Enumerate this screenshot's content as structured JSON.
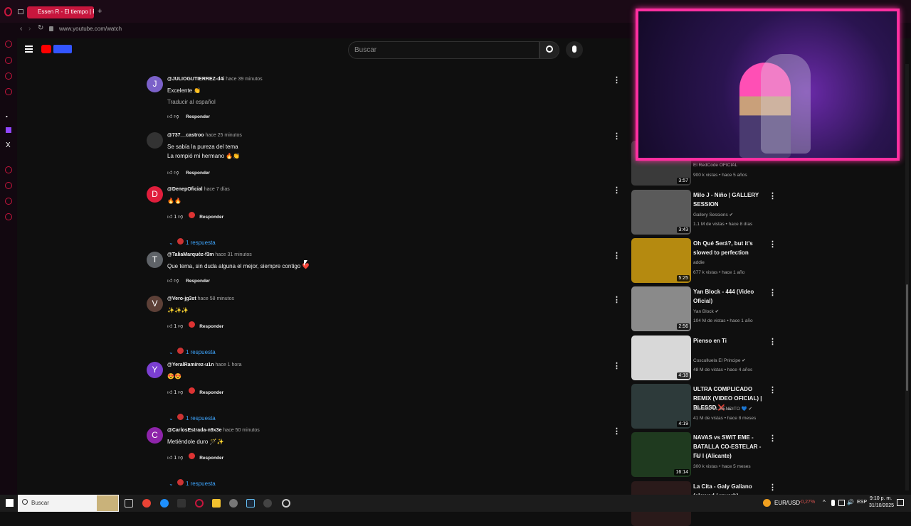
{
  "browser": {
    "tab_title": "Essen R - El tiempo | Prod",
    "url": "www.youtube.com/watch"
  },
  "youtube": {
    "search_placeholder": "Buscar"
  },
  "comments": [
    {
      "initial": "J",
      "color": "#7b61c9",
      "author": "@JULIOGUTIERREZ-d4i",
      "time": "hace 39 minutos",
      "text": "Excelente 👏",
      "translate": "Traducir al español",
      "likes": "",
      "reply": "Responder",
      "replies": ""
    },
    {
      "initial": "",
      "color": "#333333",
      "author": "@737__castroo",
      "time": "hace 25 minutos",
      "text": "Se sabía la pureza del tema",
      "text2": "La rompió mi hermano 🔥👏",
      "likes": "",
      "reply": "Responder",
      "replies": ""
    },
    {
      "initial": "D",
      "color": "#e01e3c",
      "author": "@DenepOficial",
      "time": "hace 7 días",
      "text": "🔥🔥",
      "likes": "1",
      "reply": "Responder",
      "replies": "1 respuesta"
    },
    {
      "initial": "T",
      "color": "#5f6368",
      "author": "@TaliaMarquéz-f3m",
      "time": "hace 31 minutos",
      "text": "Que tema, sin duda alguna el mejor, siempre contigo ❤️",
      "likes": "",
      "reply": "Responder",
      "replies": ""
    },
    {
      "initial": "V",
      "color": "#5d4037",
      "author": "@Vero-jg3st",
      "time": "hace 58 minutos",
      "text": "✨✨✨",
      "likes": "1",
      "reply": "Responder",
      "replies": "1 respuesta"
    },
    {
      "initial": "Y",
      "color": "#7b3fd1",
      "author": "@YeralRamírez-u1n",
      "time": "hace 1 hora",
      "text": "😍😍",
      "likes": "1",
      "reply": "Responder",
      "replies": "1 respuesta"
    },
    {
      "initial": "C",
      "color": "#8e24aa",
      "author": "@CarlosEstrada-n9x3e",
      "time": "hace 50 minutos",
      "text": "Metiéndole duro 🪄✨",
      "likes": "1",
      "reply": "Responder",
      "replies": "1 respuesta"
    }
  ],
  "sidebar": [
    {
      "title": "",
      "channel": "El RedCode OFICIAL",
      "meta": "900 k vistas • hace 5 años",
      "duration": "3:57",
      "thumb": "#3a3a3a"
    },
    {
      "title": "Milo J - Niño | GALLERY SESSION",
      "channel": "Gallery Sessions ✔",
      "meta": "1.1 M de vistas • hace 8 días",
      "duration": "3:43",
      "thumb": "#5a5a5a"
    },
    {
      "title": "Oh Qué Será?, but it's slowed to perfection",
      "channel": "addie",
      "meta": "677 k vistas • hace 1 año",
      "duration": "5:25",
      "thumb": "#b58a10"
    },
    {
      "title": "Yan Block - 444 (Video Oficial)",
      "channel": "Yan Block ✔",
      "meta": "104 M de vistas • hace 1 año",
      "duration": "2:56",
      "thumb": "#8a8a8a"
    },
    {
      "title": "Pienso en Ti",
      "channel": "Cosculluela El Principe ✔",
      "meta": "48 M de vistas • hace 4 años",
      "duration": "4:18",
      "thumb": "#d8d8d8"
    },
    {
      "title": "ULTRA COMPLICADO REMIX (VIDEO OFICIAL) | BLESSD ❌ ...",
      "channel": "BLESSD EL BENDITO 💙 ✔",
      "meta": "41 M de vistas • hace 8 meses",
      "duration": "4:19",
      "thumb": "#2d3a3a"
    },
    {
      "title": "NAVAS vs SWIT EME - BATALLA CO-ESTELAR - FU I (Alicante)",
      "channel": "FU",
      "meta": "300 k vistas • hace 5 meses",
      "duration": "16:14",
      "thumb": "#1f3a1f"
    },
    {
      "title": "La Cita - Galy Galiano (slowed / reverb)",
      "channel": "",
      "meta": "",
      "duration": "",
      "thumb": "#2a1a1a"
    }
  ],
  "taskbar": {
    "search_label": "Buscar",
    "currency": "EUR/USD",
    "currency_change": "-0,27%",
    "lang": "ESP",
    "time": "9:10 p. m.",
    "date": "31/10/2025"
  }
}
